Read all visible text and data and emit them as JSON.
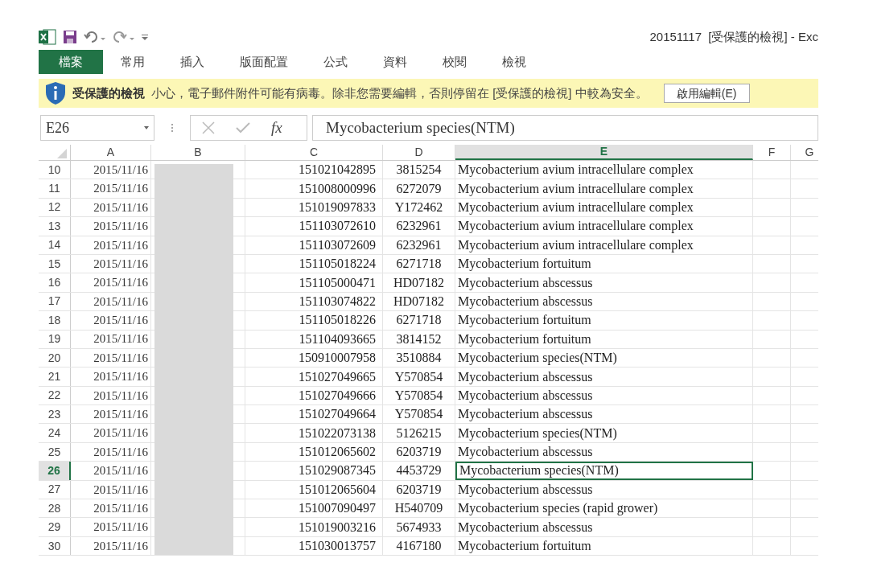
{
  "window": {
    "title": "20151117  [受保護的檢視] - Exc"
  },
  "ribbon_tabs": [
    {
      "label": "檔案",
      "selected": true
    },
    {
      "label": "常用",
      "selected": false
    },
    {
      "label": "插入",
      "selected": false
    },
    {
      "label": "版面配置",
      "selected": false
    },
    {
      "label": "公式",
      "selected": false
    },
    {
      "label": "資料",
      "selected": false
    },
    {
      "label": "校閱",
      "selected": false
    },
    {
      "label": "檢視",
      "selected": false
    }
  ],
  "message_bar": {
    "title": "受保護的檢視",
    "message": "小心，電子郵件附件可能有病毒。除非您需要編輯，否則停留在 [受保護的檢視] 中較為安全。",
    "button": "啟用編輯(E)"
  },
  "formula_bar": {
    "name_box": "E26",
    "fx": "fx",
    "value": "Mycobacterium species(NTM)"
  },
  "columns": [
    {
      "label": "A",
      "selected": false
    },
    {
      "label": "B",
      "selected": false
    },
    {
      "label": "C",
      "selected": false
    },
    {
      "label": "D",
      "selected": false
    },
    {
      "label": "E",
      "selected": true
    },
    {
      "label": "F",
      "selected": false
    },
    {
      "label": "G",
      "selected": false
    }
  ],
  "rows": [
    {
      "number": "10",
      "selected": false,
      "a": "2015/11/16",
      "c": "151021042895",
      "d": "3815254",
      "e": "Mycobacterium avium intracellulare complex"
    },
    {
      "number": "11",
      "selected": false,
      "a": "2015/11/16",
      "c": "151008000996",
      "d": "6272079",
      "e": "Mycobacterium avium intracellulare complex"
    },
    {
      "number": "12",
      "selected": false,
      "a": "2015/11/16",
      "c": "151019097833",
      "d": "Y172462",
      "e": "Mycobacterium avium intracellulare complex"
    },
    {
      "number": "13",
      "selected": false,
      "a": "2015/11/16",
      "c": "151103072610",
      "d": "6232961",
      "e": "Mycobacterium avium intracellulare complex"
    },
    {
      "number": "14",
      "selected": false,
      "a": "2015/11/16",
      "c": "151103072609",
      "d": "6232961",
      "e": "Mycobacterium avium intracellulare complex"
    },
    {
      "number": "15",
      "selected": false,
      "a": "2015/11/16",
      "c": "151105018224",
      "d": "6271718",
      "e": "Mycobacterium fortuitum"
    },
    {
      "number": "16",
      "selected": false,
      "a": "2015/11/16",
      "c": "151105000471",
      "d": "HD07182",
      "e": "Mycobacterium abscessus"
    },
    {
      "number": "17",
      "selected": false,
      "a": "2015/11/16",
      "c": "151103074822",
      "d": "HD07182",
      "e": "Mycobacterium abscessus"
    },
    {
      "number": "18",
      "selected": false,
      "a": "2015/11/16",
      "c": "151105018226",
      "d": "6271718",
      "e": "Mycobacterium fortuitum"
    },
    {
      "number": "19",
      "selected": false,
      "a": "2015/11/16",
      "c": "151104093665",
      "d": "3814152",
      "e": "Mycobacterium fortuitum"
    },
    {
      "number": "20",
      "selected": false,
      "a": "2015/11/16",
      "c": "150910007958",
      "d": "3510884",
      "e": "Mycobacterium species(NTM)"
    },
    {
      "number": "21",
      "selected": false,
      "a": "2015/11/16",
      "c": "151027049665",
      "d": "Y570854",
      "e": "Mycobacterium abscessus"
    },
    {
      "number": "22",
      "selected": false,
      "a": "2015/11/16",
      "c": "151027049666",
      "d": "Y570854",
      "e": "Mycobacterium abscessus"
    },
    {
      "number": "23",
      "selected": false,
      "a": "2015/11/16",
      "c": "151027049664",
      "d": "Y570854",
      "e": "Mycobacterium abscessus"
    },
    {
      "number": "24",
      "selected": false,
      "a": "2015/11/16",
      "c": "151022073138",
      "d": "5126215",
      "e": "Mycobacterium species(NTM)"
    },
    {
      "number": "25",
      "selected": false,
      "a": "2015/11/16",
      "c": "151012065602",
      "d": "6203719",
      "e": "Mycobacterium abscessus"
    },
    {
      "number": "26",
      "selected": true,
      "a": "2015/11/16",
      "c": "151029087345",
      "d": "4453729",
      "e": "Mycobacterium species(NTM)"
    },
    {
      "number": "27",
      "selected": false,
      "a": "2015/11/16",
      "c": "151012065604",
      "d": "6203719",
      "e": "Mycobacterium abscessus"
    },
    {
      "number": "28",
      "selected": false,
      "a": "2015/11/16",
      "c": "151007090497",
      "d": "H540709",
      "e": "Mycobacterium species (rapid grower)"
    },
    {
      "number": "29",
      "selected": false,
      "a": "2015/11/16",
      "c": "151019003216",
      "d": "5674933",
      "e": "Mycobacterium abscessus"
    },
    {
      "number": "30",
      "selected": false,
      "a": "2015/11/16",
      "c": "151030013757",
      "d": "4167180",
      "e": "Mycobacterium fortuitum"
    }
  ]
}
